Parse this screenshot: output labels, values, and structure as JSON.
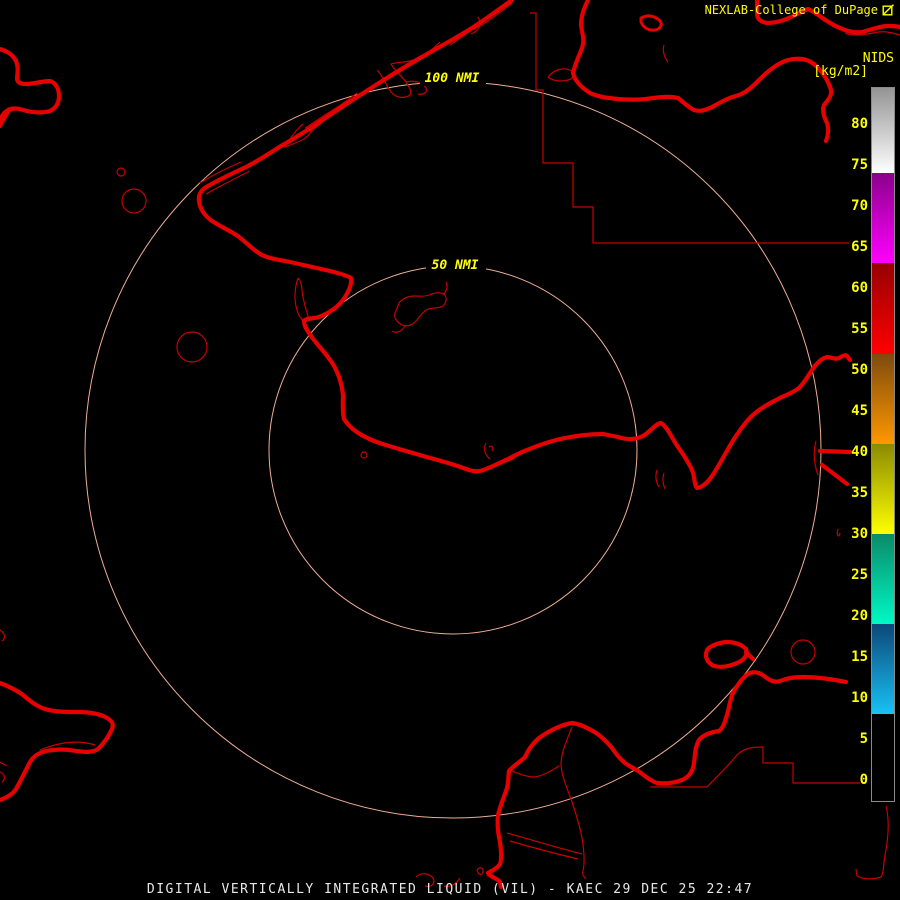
{
  "header": {
    "brand": "NEXLAB-College of DuPage",
    "logo_icon": "square-diagonal-logo"
  },
  "colorbar": {
    "title": "NIDS",
    "units": "[kg/m2]",
    "ticks": [
      80,
      75,
      70,
      65,
      60,
      55,
      50,
      45,
      40,
      35,
      30,
      25,
      20,
      15,
      10,
      5,
      0
    ],
    "segments": [
      {
        "from": 8,
        "to": 19,
        "bottom_color": "#18C2F5",
        "top_color": "#0B4878"
      },
      {
        "from": 19,
        "to": 30,
        "bottom_color": "#00F9C5",
        "top_color": "#0A8A68"
      },
      {
        "from": 30,
        "to": 41,
        "bottom_color": "#FFFF00",
        "top_color": "#8A8A00"
      },
      {
        "from": 41,
        "to": 52,
        "bottom_color": "#FF9800",
        "top_color": "#7E4A0E"
      },
      {
        "from": 52,
        "to": 63,
        "bottom_color": "#FF0000",
        "top_color": "#960000"
      },
      {
        "from": 63,
        "to": 74,
        "bottom_color": "#FF00FF",
        "top_color": "#8B008B"
      },
      {
        "from": 74,
        "to": 84.5,
        "bottom_color": "#FFFFFF",
        "top_color": "#949494"
      }
    ]
  },
  "rings": {
    "outer_label": "100 NMI",
    "inner_label": "50 NMI"
  },
  "footer": {
    "product_title": "DIGITAL VERTICALLY INTEGRATED LIQUID (VIL) - KAEC 29 DEC 25 22:47"
  },
  "colors": {
    "background": "#000000",
    "map_outline_thick": "#E60000",
    "map_outline_thin": "#C80000",
    "range_ring": "#EFAE94",
    "label_yellow": "#FFFF00",
    "title_white": "#E8E8E8"
  }
}
